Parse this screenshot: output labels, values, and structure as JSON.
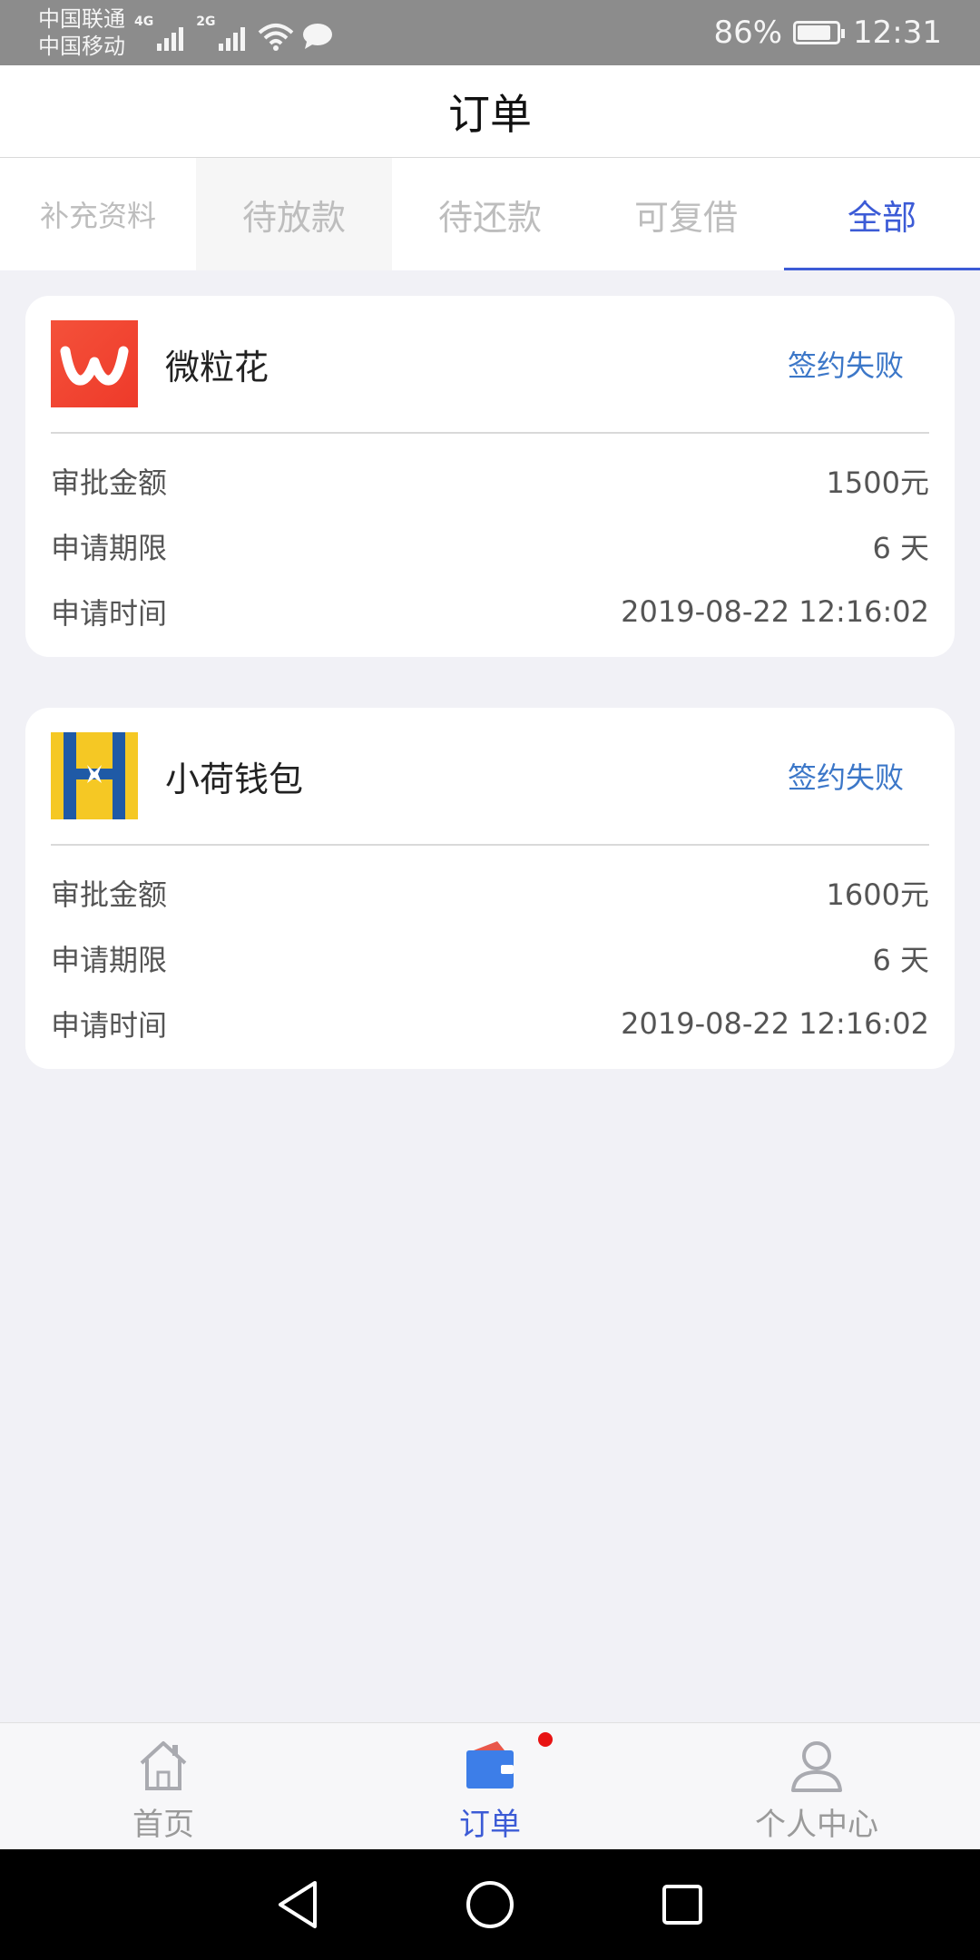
{
  "status_bar": {
    "carrier_1": "中国联通",
    "carrier_2": "中国移动",
    "net_1": "4G",
    "net_2": "2G",
    "battery_percent": "86%",
    "battery_level": 0.86,
    "time": "12:31"
  },
  "header": {
    "title": "订单"
  },
  "tabs": [
    {
      "label": "补充资料"
    },
    {
      "label": "待放款"
    },
    {
      "label": "待还款"
    },
    {
      "label": "可复借"
    },
    {
      "label": "全部"
    }
  ],
  "orders": [
    {
      "lender": "微粒花",
      "logo_icon": "weilihua-logo-icon",
      "status": "签约失败",
      "rows": [
        {
          "label": "审批金额",
          "value": "1500元"
        },
        {
          "label": "申请期限",
          "value": "6 天"
        },
        {
          "label": "申请时间",
          "value": "2019-08-22 12:16:02"
        }
      ]
    },
    {
      "lender": "小荷钱包",
      "logo_icon": "xiaohe-logo-icon",
      "status": "签约失败",
      "rows": [
        {
          "label": "审批金额",
          "value": "1600元"
        },
        {
          "label": "申请期限",
          "value": "6 天"
        },
        {
          "label": "申请时间",
          "value": "2019-08-22 12:16:02"
        }
      ]
    }
  ],
  "bottom_nav": [
    {
      "label": "首页",
      "icon": "home-icon"
    },
    {
      "label": "订单",
      "icon": "wallet-icon"
    },
    {
      "label": "个人中心",
      "icon": "person-icon"
    }
  ],
  "colors": {
    "accent": "#3c5bd6",
    "status_link": "#3c77c8",
    "badge": "#e81313",
    "weilihua_brand": "#f0432d",
    "xiaohe_yellow": "#f5c824",
    "xiaohe_blue": "#1f5aa6"
  }
}
